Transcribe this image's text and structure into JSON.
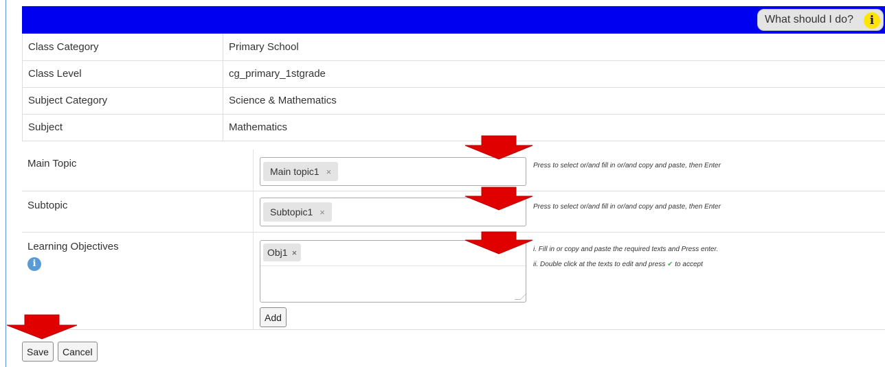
{
  "header": {
    "help_label": "What should I do?",
    "help_icon": "i"
  },
  "info_rows": [
    {
      "label": "Class Category",
      "value": "Primary School"
    },
    {
      "label": "Class Level",
      "value": "cg_primary_1stgrade"
    },
    {
      "label": "Subject Category",
      "value": "Science & Mathematics"
    },
    {
      "label": "Subject",
      "value": "Mathematics"
    }
  ],
  "form": {
    "main_topic": {
      "label": "Main Topic",
      "tag": "Main topic1",
      "remove": "×",
      "hint": "Press to select or/and fill in or/and copy and paste, then Enter"
    },
    "subtopic": {
      "label": "Subtopic",
      "tag": "Subtopic1",
      "remove": "×",
      "hint": "Press to select or/and fill in or/and copy and paste, then Enter"
    },
    "objectives": {
      "label": "Learning Objectives",
      "tag": "Obj1",
      "remove": "×",
      "hint1": "i. Fill in or copy and paste the required texts and Press enter.",
      "hint2": "ii. Double click at the texts to edit and press",
      "hint2_end": "to accept",
      "add_label": "Add"
    }
  },
  "actions": {
    "save_label": "Save",
    "cancel_label": "Cancel"
  },
  "colors": {
    "topbar": "#0000f0",
    "arrow": "#e00000",
    "badge": "#ffe600",
    "info": "#5b9bd5"
  },
  "icons": [
    "info-icon",
    "arrow-down-icon",
    "check-icon"
  ]
}
